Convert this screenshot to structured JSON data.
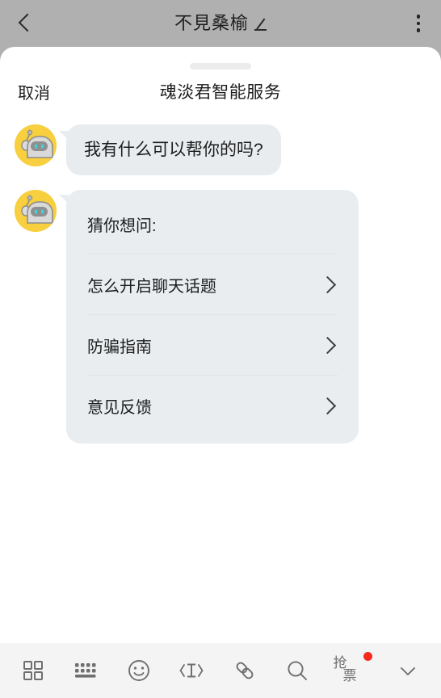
{
  "navbar": {
    "back_icon": "chevron-left-icon",
    "title": "不見桑榆",
    "edit_icon": "pencil-icon",
    "menu_icon": "more-vertical-icon"
  },
  "sheet": {
    "cancel_label": "取消",
    "title": "魂淡君智能服务"
  },
  "chat": {
    "messages": [
      {
        "sender": "bot",
        "avatar_icon": "robot-avatar-icon",
        "text": "我有什么可以帮你的吗?"
      }
    ],
    "suggestion_card": {
      "avatar_icon": "robot-avatar-icon",
      "title": "猜你想问:",
      "items": [
        {
          "label": "怎么开启聊天话题",
          "chevron": "chevron-right-icon"
        },
        {
          "label": "防骗指南",
          "chevron": "chevron-right-icon"
        },
        {
          "label": "意见反馈",
          "chevron": "chevron-right-icon"
        }
      ]
    }
  },
  "toolbar": {
    "items": [
      {
        "name": "grid-icon",
        "label": ""
      },
      {
        "name": "keyboard-icon",
        "label": ""
      },
      {
        "name": "smiley-icon",
        "label": ""
      },
      {
        "name": "text-cursor-icon",
        "label": ""
      },
      {
        "name": "link-icon",
        "label": ""
      },
      {
        "name": "search-icon",
        "label": ""
      }
    ],
    "ticket": {
      "char_top": "抢",
      "char_bottom": "票",
      "badge": true
    },
    "collapse_icon": "chevron-down-icon"
  },
  "colors": {
    "navbar_bg": "#b0b0b0",
    "sheet_bg": "#ffffff",
    "bubble_bg": "#e8ecef",
    "card_bg": "#e9edf0",
    "toolbar_bg": "#f4f4f4",
    "avatar_bg": "#f7cf3f",
    "badge_red": "#f7281d",
    "robot_body": "#d4d4d4",
    "robot_eye": "#3fd6d6"
  }
}
